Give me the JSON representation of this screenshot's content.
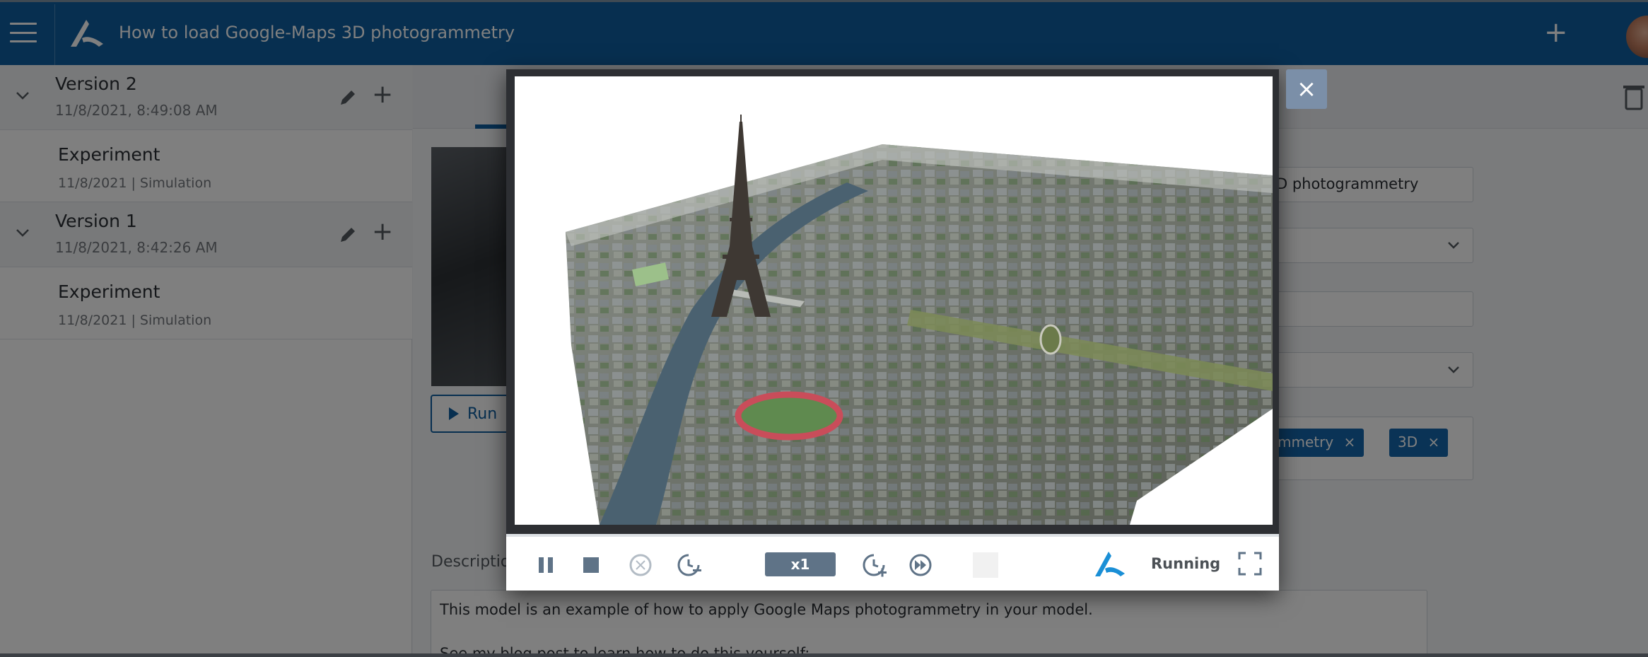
{
  "header": {
    "title": "How to load Google-Maps 3D photogrammetry",
    "menu_icon": "hamburger-menu-icon",
    "logo_icon": "anylogic-logo-icon",
    "add_icon": "plus-icon"
  },
  "sidebar": {
    "versions": [
      {
        "name": "Version 2",
        "date": "11/8/2021, 8:49:08 AM",
        "experiment": {
          "name": "Experiment",
          "meta": "11/8/2021 | Simulation"
        }
      },
      {
        "name": "Version 1",
        "date": "11/8/2021, 8:42:26 AM",
        "experiment": {
          "name": "Experiment",
          "meta": "11/8/2021 | Simulation"
        }
      }
    ],
    "add_symbol": "+"
  },
  "main": {
    "run_label": "Run",
    "name_field_value": "D photogrammetry",
    "tags": [
      {
        "label": "mmetry",
        "remove": "×"
      },
      {
        "label": "3D",
        "remove": "×"
      }
    ],
    "description_label": "Descriptio",
    "description_lines": [
      "This model is an example of how to apply Google Maps photogrammetry in your model.",
      "See my blog post to learn how to do this yourself:"
    ]
  },
  "player": {
    "speed_label": "x1",
    "status": "Running",
    "close_symbol": "×",
    "scene": "3D photogrammetry of Paris with the Eiffel Tower, Seine river and Champ de Mars"
  },
  "colors": {
    "brand_blue": "#0e5fa0",
    "tag_blue": "#1467ad",
    "speed_bg": "#5f7387",
    "close_bg": "#7b8fa8"
  }
}
